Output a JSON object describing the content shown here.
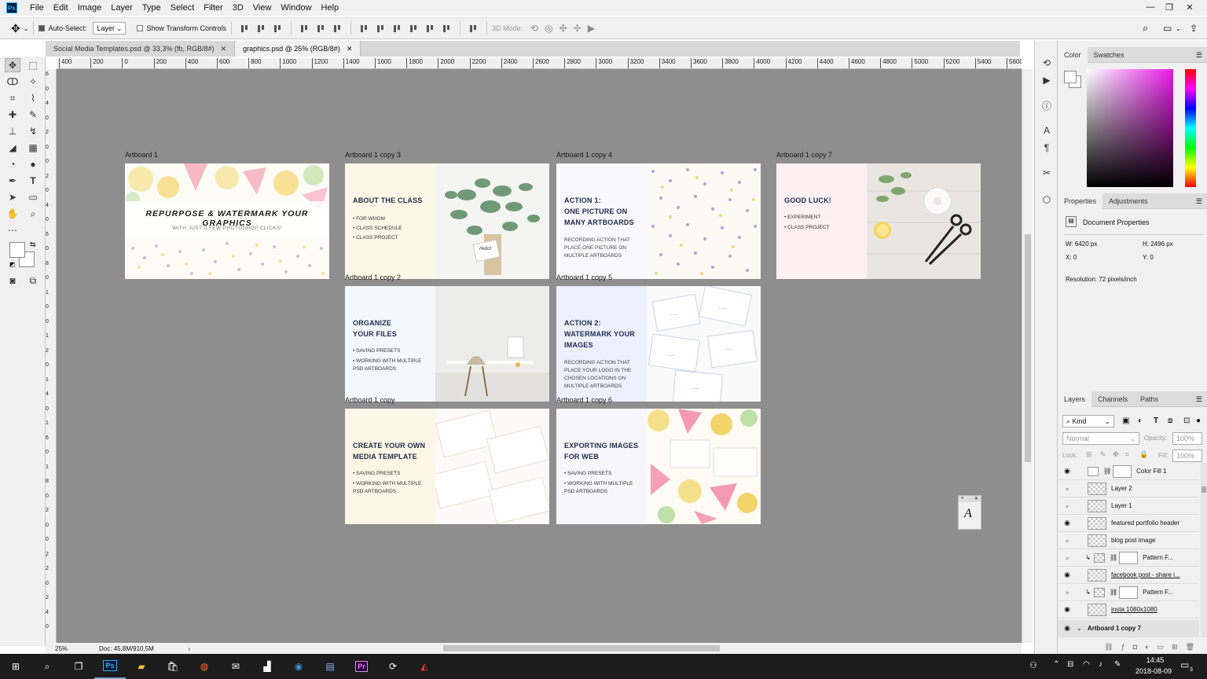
{
  "app": {
    "logo": "Ps"
  },
  "menu": [
    "File",
    "Edit",
    "Image",
    "Layer",
    "Type",
    "Select",
    "Filter",
    "3D",
    "View",
    "Window",
    "Help"
  ],
  "window_controls": {
    "minimize": "—",
    "restore": "❐",
    "close": "✕"
  },
  "options": {
    "auto_select_label": "Auto-Select:",
    "auto_select_value": "Layer",
    "show_transform_label": "Show Transform Controls",
    "mode_3d_label": "3D Mode:"
  },
  "tabs": [
    {
      "label": "Social Media Templates.psd @ 33,3% (fb, RGB/8#)",
      "close": "✕"
    },
    {
      "label": "graphics.psd @ 25% (RGB/8#)",
      "close": "✕"
    }
  ],
  "ruler": {
    "h_ticks": [
      "400",
      "200",
      "0",
      "200",
      "400",
      "600",
      "800",
      "1000",
      "1200",
      "1400",
      "1600",
      "1800",
      "2000",
      "2200",
      "2400",
      "2600",
      "2800",
      "3000",
      "3200",
      "3400",
      "3600",
      "3800",
      "4000",
      "4200",
      "4400",
      "4600",
      "4800",
      "5000",
      "5200",
      "5400",
      "5600"
    ],
    "v_ticks": [
      "6",
      "0",
      "4",
      "0",
      "2",
      "0",
      "0",
      "2",
      "0",
      "4",
      "0",
      "6",
      "0",
      "8",
      "0",
      "1",
      "0",
      "0",
      "1",
      "2",
      "0",
      "1",
      "4",
      "0",
      "1",
      "6",
      "0",
      "1",
      "8",
      "0",
      "2",
      "0",
      "0",
      "2",
      "2",
      "0",
      "2",
      "4",
      "0"
    ]
  },
  "artboards": [
    {
      "label": "Artboard 1",
      "headline": "REPURPOSE & WATERMARK YOUR GRAPHICS",
      "subline": "WITH JUST A FEW PHOTOSHOP CLICKS!"
    },
    {
      "label": "Artboard 1 copy 3",
      "title": [
        "ABOUT THE CLASS"
      ],
      "bullets": [
        "• FOR WHOM",
        "• CLASS SCHEDULE",
        "• CLASS PROJECT"
      ],
      "tag": "Hello!"
    },
    {
      "label": "Artboard 1 copy 4",
      "title": [
        "ACTION 1:",
        " ONE PICTURE ON",
        "MANY ARTBOARDS"
      ],
      "desc": "RECORDING ACTION THAT PLACE ONE PICTURE ON MULTIPLE ARTBOARDS"
    },
    {
      "label": "Artboard 1 copy 7",
      "title": [
        "GOOD LUCK!"
      ],
      "bullets": [
        "• EXPERIMENT",
        "• CLASS PROJECT"
      ]
    },
    {
      "label": "Artboard 1 copy 2",
      "title": [
        "ORGANIZE",
        "YOUR FILES"
      ],
      "bullets": [
        "• SAVING PRESETS",
        "• WORKING WITH MULTIPLE",
        "  PSD ARTBOARDS"
      ]
    },
    {
      "label": "Artboard 1 copy 5",
      "title": [
        "ACTION 2:",
        "WATERMARK YOUR",
        "IMAGES"
      ],
      "desc": "RECORDING ACTION THAT PLACE YOUR LOGO IN THE CHOSEN LOCATIONS ON MULTIPLE ARTBOARDS"
    },
    {
      "label": "Artboard 1 copy",
      "title": [
        "CREATE YOUR OWN",
        "MEDIA TEMPLATE"
      ],
      "bullets": [
        "• SAVING PRESETS",
        "• WORKING WITH MULTIPLE",
        "  PSD ARTBOARDS"
      ]
    },
    {
      "label": "Artboard 1 copy 6",
      "title": [
        "EXPORTING IMAGES",
        "FOR WEB"
      ],
      "bullets": [
        "• SAVING PRESETS",
        "• WORKING WITH MULTIPLE",
        "  PSD ARTBOARDS"
      ]
    }
  ],
  "status": {
    "zoom": "25%",
    "doc": "Doc: 45,8M/910,5M"
  },
  "panels": {
    "color_tabs": [
      "Color",
      "Swatches"
    ],
    "props_tabs": [
      "Properties",
      "Adjustments"
    ],
    "doc_props_title": "Document Properties",
    "w": "W:  6420 px",
    "h": "H:  2496 px",
    "x": "X:  0",
    "y": "Y:  0",
    "resolution": "Resolution:  72 pixels/inch",
    "layers_tabs": [
      "Layers",
      "Channels",
      "Paths"
    ],
    "kind_label": "Kind",
    "blend": "Normal",
    "opacity_label": "Opacity:",
    "opacity": "100%",
    "lock_label": "Lock:",
    "fill_label": "Fill:",
    "fill": "100%",
    "layers": [
      {
        "name": "Color Fill 1",
        "visible": true
      },
      {
        "name": "Layer 2",
        "visible": false
      },
      {
        "name": "Layer 1",
        "visible": false
      },
      {
        "name": "featured portfolio header",
        "visible": true
      },
      {
        "name": "blog post image",
        "visible": false
      },
      {
        "name": "Pattern F...",
        "visible": false
      },
      {
        "name": "facebook post - share i...",
        "visible": true
      },
      {
        "name": "Pattern F...",
        "visible": false
      },
      {
        "name": "insta 1080x1080",
        "visible": true
      },
      {
        "name": "Artboard 1 copy 7",
        "visible": true
      }
    ]
  },
  "float_panel_glyph": "A",
  "taskbar": {
    "time": "14:45",
    "date": "2018-08-09",
    "notif": "3",
    "ps_label": "Ps",
    "pr_label": "Pr"
  },
  "colors": {
    "accent_ps": "#31a8ff",
    "canvas": "#8e8e8e",
    "title_navy": "#1e2a4a"
  }
}
